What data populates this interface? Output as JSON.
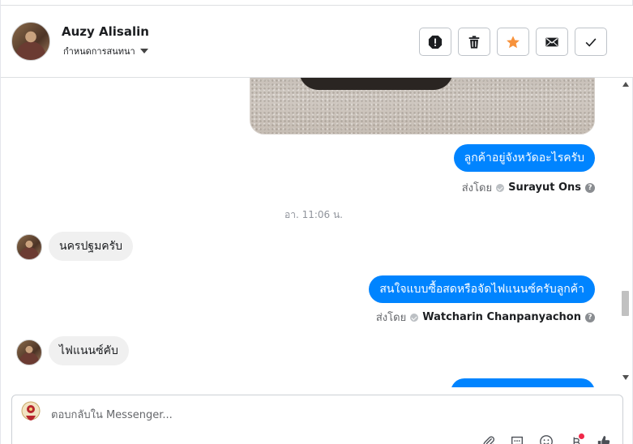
{
  "header": {
    "contact_name": "Auzy Alisalin",
    "subtitle": "กำหนดการสนทนา",
    "actions": [
      {
        "name": "report-icon"
      },
      {
        "name": "trash-icon"
      },
      {
        "name": "star-icon",
        "color": "#f7923b"
      },
      {
        "name": "envelope-icon"
      },
      {
        "name": "checkmark-icon"
      }
    ]
  },
  "conversation": {
    "messages": [
      {
        "direction": "outgoing",
        "text": "ลูกค้าอยู่จังหวัดอะไรครับ",
        "sent_by_label": "ส่งโดย",
        "sender": "Surayut Ons"
      },
      {
        "timestamp": "อา. 11:06 น."
      },
      {
        "direction": "incoming",
        "text": "นครปฐมครับ"
      },
      {
        "direction": "outgoing",
        "text": "สนใจแบบซื้อสดหรือจัดไฟแนนซ์ครับลูกค้า",
        "sent_by_label": "ส่งโดย",
        "sender": "Watcharin Chanpanyachon"
      },
      {
        "direction": "incoming",
        "text": "ไฟแนนซ์คับ"
      }
    ]
  },
  "composer": {
    "placeholder": "ตอบกลับใน Messenger...",
    "value": ""
  },
  "colors": {
    "accent": "#0084ff",
    "incoming_bubble": "#f0f0f0",
    "star": "#f7923b",
    "notification_dot": "#f02849"
  }
}
